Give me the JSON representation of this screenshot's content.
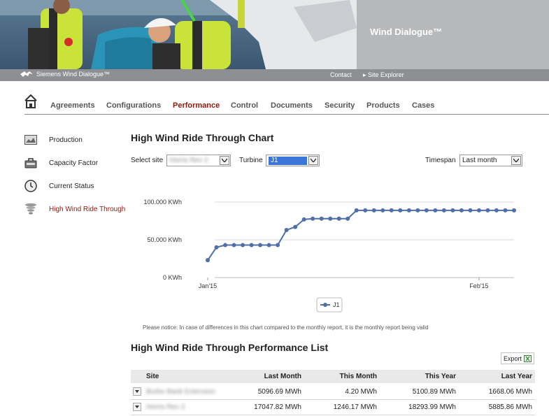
{
  "banner": {
    "title": "Wind Dialogue™"
  },
  "strip": {
    "brand": "Siemens Wind Dialogue™",
    "contact": "Contact",
    "site_explorer": "Site Explorer"
  },
  "tabs": [
    {
      "label": "Agreements",
      "active": false
    },
    {
      "label": "Configurations",
      "active": false
    },
    {
      "label": "Performance",
      "active": true
    },
    {
      "label": "Control",
      "active": false
    },
    {
      "label": "Documents",
      "active": false
    },
    {
      "label": "Security",
      "active": false
    },
    {
      "label": "Products",
      "active": false
    },
    {
      "label": "Cases",
      "active": false
    }
  ],
  "sidebar": {
    "items": [
      {
        "label": "Production",
        "icon": "production-icon",
        "active": false
      },
      {
        "label": "Capacity Factor",
        "icon": "capacity-factor-icon",
        "active": false
      },
      {
        "label": "Current Status",
        "icon": "clock-icon",
        "active": false
      },
      {
        "label": "High Wind Ride Through",
        "icon": "tornado-icon",
        "active": true
      }
    ]
  },
  "main": {
    "title": "High Wind Ride Through Chart",
    "select_site_label": "Select site",
    "site_value": "Horns Rev 2",
    "turbine_label": "Turbine",
    "turbine_value": "J1",
    "timespan_label": "Timespan",
    "timespan_value": "Last month",
    "notice": "Please notice: In case of differences in this chart compared to the monthly report, it is the monthly report being valid"
  },
  "colors": {
    "accent": "#8b1a12",
    "series": "#4f6fa8",
    "strip": "#8d8f92",
    "banner_right": "#b6b8ba"
  },
  "chart_data": {
    "type": "line",
    "ytick_labels": [
      "100.000 KWh",
      "50.000 KWh",
      "0 KWh"
    ],
    "yticks": [
      100000,
      50000,
      0
    ],
    "ylim": [
      0,
      100000
    ],
    "xtick_labels": [
      "Jan'15",
      "Feb'15"
    ],
    "xticks": [
      "2015-01-01",
      "2015-02-01"
    ],
    "xlim": [
      "2015-01-01",
      "2015-02-05"
    ],
    "grid": true,
    "legend": "bottom",
    "series": [
      {
        "name": "J1",
        "x": [
          "2015-01-01",
          "2015-01-02",
          "2015-01-03",
          "2015-01-04",
          "2015-01-05",
          "2015-01-06",
          "2015-01-07",
          "2015-01-08",
          "2015-01-09",
          "2015-01-10",
          "2015-01-11",
          "2015-01-12",
          "2015-01-13",
          "2015-01-14",
          "2015-01-15",
          "2015-01-16",
          "2015-01-17",
          "2015-01-18",
          "2015-01-19",
          "2015-01-20",
          "2015-01-21",
          "2015-01-22",
          "2015-01-23",
          "2015-01-24",
          "2015-01-25",
          "2015-01-26",
          "2015-01-27",
          "2015-01-28",
          "2015-01-29",
          "2015-01-30",
          "2015-01-31",
          "2015-02-01",
          "2015-02-02",
          "2015-02-03",
          "2015-02-04",
          "2015-02-05"
        ],
        "y": [
          23000,
          40000,
          43000,
          43000,
          43000,
          43000,
          43000,
          43000,
          43000,
          63000,
          67000,
          77000,
          78000,
          78000,
          78000,
          78000,
          78000,
          89000,
          89000,
          89000,
          89000,
          89000,
          89000,
          89000,
          89000,
          89000,
          89000,
          89000,
          89000,
          89000,
          89000,
          89000,
          89000,
          89000,
          89000,
          89000
        ]
      }
    ]
  },
  "list": {
    "title": "High Wind Ride Through Performance List",
    "export_label": "Export",
    "columns": [
      "Site",
      "Last Month",
      "This Month",
      "This Year",
      "Last Year"
    ],
    "rows": [
      {
        "site": "Burbo Bank Extension",
        "last_month": "5096.69 MWh",
        "this_month": "4.20 MWh",
        "this_year": "5100.89 MWh",
        "last_year": "1668.06 MWh"
      },
      {
        "site": "Horns Rev 2",
        "last_month": "17047.82 MWh",
        "this_month": "1246.17 MWh",
        "this_year": "18293.99 MWh",
        "last_year": "5885.86 MWh"
      }
    ]
  }
}
